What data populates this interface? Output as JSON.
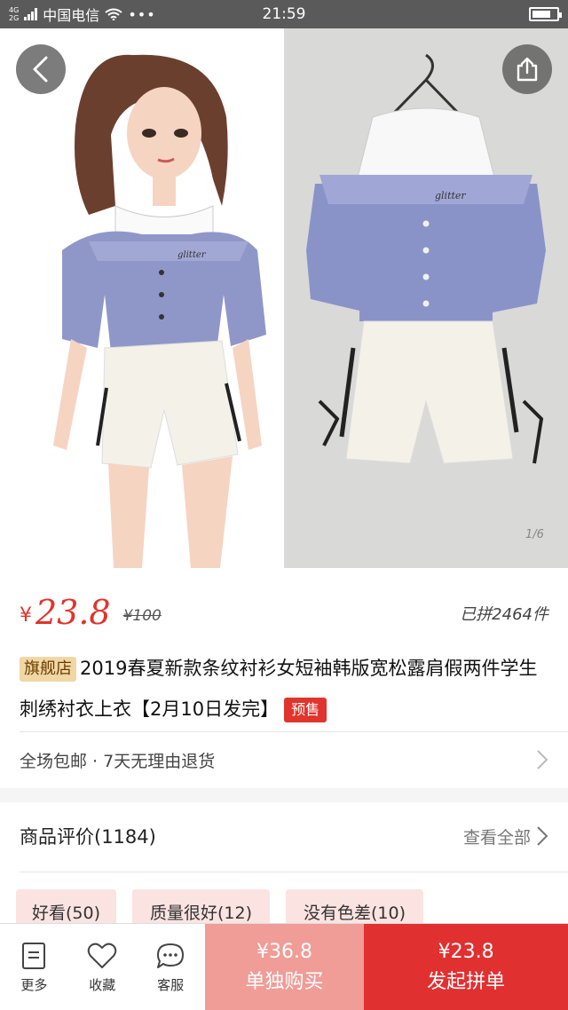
{
  "status_bar": {
    "network_top": "4G",
    "network_bottom": "2G",
    "carrier": "中国电信",
    "more": "•••",
    "time": "21:59",
    "battery_level": 0.78
  },
  "hero": {
    "back_icon": "chevron-left-icon",
    "share_icon": "share-icon",
    "page_indicator": "1/6"
  },
  "product": {
    "currency": "¥",
    "price": "23.8",
    "original_price": "¥100",
    "sold": "已拼2464件",
    "shop_tag": "旗舰店",
    "title": "2019春夏新款条纹衬衫女短袖韩版宽松露肩假两件学生刺绣衬衣上衣【2月10日发完】",
    "presale_tag": "预售",
    "services": "全场包邮 · 7天无理由退货"
  },
  "reviews": {
    "title": "商品评价(1184)",
    "view_all": "查看全部",
    "chips": [
      "好看(50)",
      "质量很好(12)",
      "没有色差(10)"
    ]
  },
  "bottom_bar": {
    "more_label": "更多",
    "favorite_label": "收藏",
    "service_label": "客服",
    "solo_price": "¥36.8",
    "solo_label": "单独购买",
    "group_price": "¥23.8",
    "group_label": "发起拼单"
  },
  "colors": {
    "accent_red": "#e0342c",
    "solo_button": "#f09c97",
    "group_button": "#e13030",
    "shop_tag_bg": "#f0d7a4",
    "chip_bg": "#fbe3e1"
  }
}
